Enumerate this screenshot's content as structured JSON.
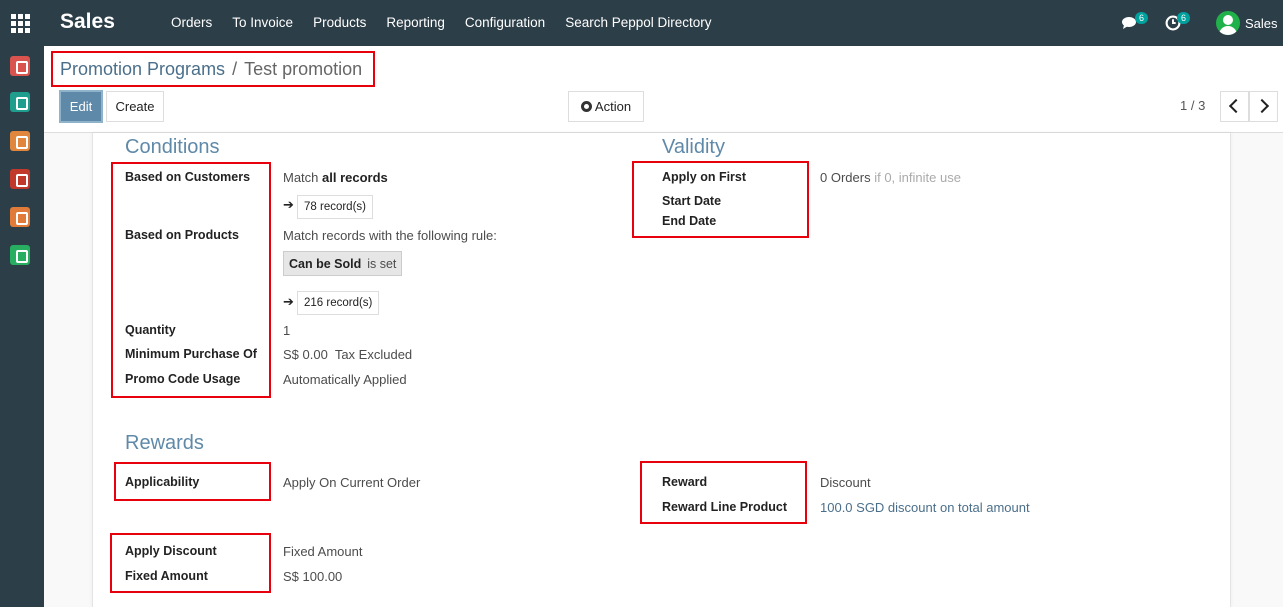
{
  "topbar": {
    "app_title": "Sales",
    "menu": [
      "Orders",
      "To Invoice",
      "Products",
      "Reporting",
      "Configuration",
      "Search Peppol Directory"
    ],
    "messages_count": "6",
    "activities_count": "6",
    "user_name": "Sales"
  },
  "breadcrumb": {
    "parent": "Promotion Programs",
    "separator": "/",
    "current": "Test promotion"
  },
  "toolbar": {
    "edit_label": "Edit",
    "create_label": "Create",
    "action_label": "Action",
    "pager": "1 / 3"
  },
  "conditions": {
    "title": "Conditions",
    "based_on_customers_label": "Based on Customers",
    "customers_prefix": "Match",
    "customers_bold": "all records",
    "customers_records": "78 record(s)",
    "based_on_products_label": "Based on Products",
    "products_rule_text": "Match records with the following rule:",
    "rule_field": "Can be Sold",
    "rule_op": "is set",
    "products_records": "216 record(s)",
    "quantity_label": "Quantity",
    "quantity_value": "1",
    "min_purchase_label": "Minimum Purchase Of",
    "min_purchase_value": "S$ 0.00",
    "min_purchase_tax": "Tax Excluded",
    "promo_usage_label": "Promo Code Usage",
    "promo_usage_value": "Automatically Applied"
  },
  "validity": {
    "title": "Validity",
    "apply_first_label": "Apply on First",
    "apply_first_value": "0 Orders",
    "apply_first_hint": "if 0, infinite use",
    "start_date_label": "Start Date",
    "end_date_label": "End Date"
  },
  "rewards": {
    "title": "Rewards",
    "applicability_label": "Applicability",
    "applicability_value": "Apply On Current Order",
    "reward_label": "Reward",
    "reward_value": "Discount",
    "reward_line_label": "Reward Line Product",
    "reward_line_value": "100.0 SGD discount on total amount",
    "apply_discount_label": "Apply Discount",
    "apply_discount_value": "Fixed Amount",
    "fixed_amount_label": "Fixed Amount",
    "fixed_amount_value": "S$ 100.00"
  },
  "colors": {
    "nav": "#2c3e48",
    "primary": "#5f89a8",
    "highlight": "#e8000d",
    "badge": "#00a09d"
  },
  "icons": [
    "apps-grid-icon",
    "chat-icon",
    "clock-icon",
    "user-avatar-icon",
    "gear-icon",
    "arrow-right-icon",
    "chevron-left-icon",
    "chevron-right-icon"
  ]
}
